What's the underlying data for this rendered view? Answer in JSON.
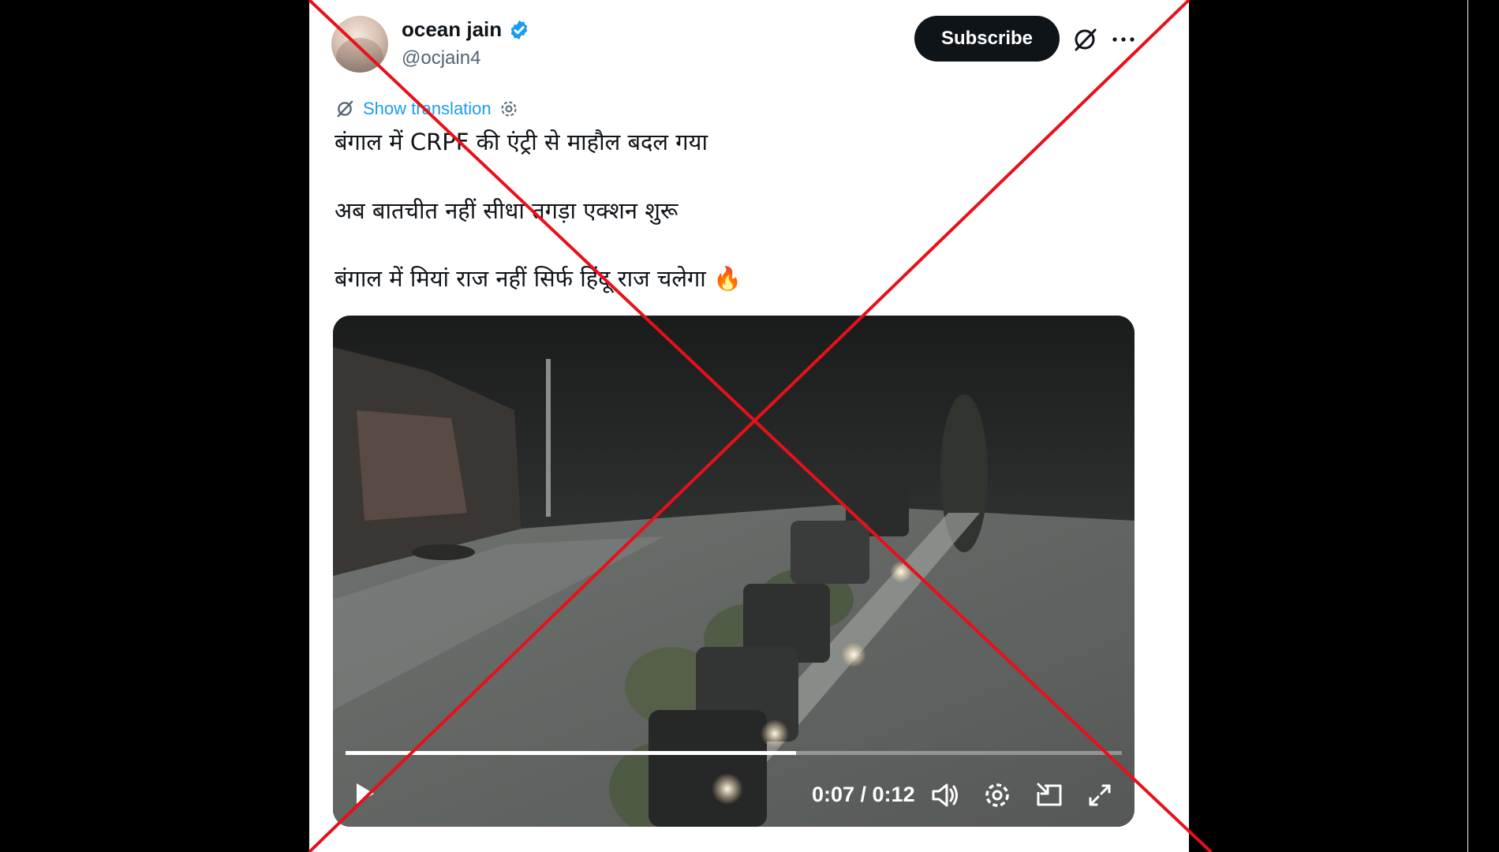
{
  "author": {
    "display_name": "ocean jain",
    "handle": "@ocjain4",
    "verified": true
  },
  "header": {
    "subscribe_label": "Subscribe",
    "icons": [
      "grok-icon",
      "more-options-icon"
    ]
  },
  "translation": {
    "label": "Show translation",
    "icons": [
      "grok-icon",
      "settings-icon"
    ]
  },
  "tweet": {
    "line1": "बंगाल में CRPF की एंट्री से माहौल बदल गया",
    "line2": "अब बातचीत नहीं सीधा तगड़ा एक्शन शुरू",
    "line3": "बंगाल में मियां राज नहीं सिर्फ हिंदू राज चलेगा 🔥"
  },
  "video": {
    "time_display": "0:07 / 0:12",
    "progress_fraction": 0.58,
    "controls": [
      "play-icon",
      "volume-icon",
      "settings-icon",
      "pip-icon",
      "fullscreen-icon"
    ]
  },
  "overlay": {
    "cross_color": "#e8101a"
  },
  "colors": {
    "accent": "#1d9bf0",
    "text": "#0f1419",
    "secondary": "#536471"
  }
}
